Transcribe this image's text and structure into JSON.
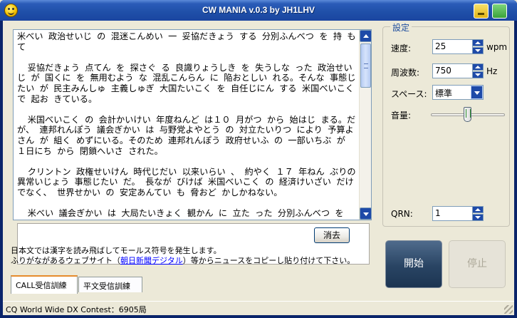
{
  "window": {
    "title": "CW MANIA v.0.3 by JH1LHV"
  },
  "text_area": {
    "content": "米べい 政治せいじ の 混迷こんめい 一 妥協だきょう する 分別ふんべつ を 持 もて\n\n  妥協だきょう 点てん を 探さぐ る 良識りょうしき を 失うしな った 政治せいじ が 国くに を 無用むよう な 混乱こんらん に 陥おとしい れる。そんな 事態じたい が 民主みんしゅ 主義しゅぎ 大国たいこく を 自任じにん する 米国べいこく で 起お きている。\n\n  米国べいこく の 会計かいけい 年度ねんど は１０ 月がつ から 始はじ まる。だが、 連邦れんぽう 議会ぎかい は 与野党よやとう の 対立たいりつ により 予算よさん が 組く めずにいる。そのため 連邦れんぽう 政府せいふ の 一部いちぶ が １日にち から 閉鎖へいさ された。\n\n  クリントン 政権せいけん 時代じだい 以来いらい 、 約やく １７ 年ねん ぶりの 異常いじょう 事態じたい だ。 長なが びけば 米国べいこく の 経済けいざい だけでなく、 世界せかい の 安定あんてい も 脅おど かしかねない。\n\n  米べい 議会ぎかい は 大局たいきょく 観かん に 立た った 分別ふんべつ を 取 と りもどし、 政府せいふ 機能きのう を 早はや く 正常せ"
  },
  "info": {
    "clear_button": "消去",
    "line1": "日本文では漢字を読み飛ばしてモールス符号を発生します。",
    "line2_prefix": "ふりがながあるウェブサイト（",
    "line2_link": "朝日新聞デジタル",
    "line2_suffix": "）等からニュースをコピーし貼り付けて下さい。"
  },
  "tabs": [
    {
      "label": "CALL受信訓練",
      "active": true
    },
    {
      "label": "平文受信訓練",
      "active": false
    }
  ],
  "status_bar": {
    "text": "CQ World Wide DX Contest：6905局"
  },
  "settings": {
    "group_title": "設定",
    "speed_label": "速度:",
    "speed_value": "25",
    "speed_unit": "wpm",
    "freq_label": "周波数:",
    "freq_value": "750",
    "freq_unit": "Hz",
    "space_label": "スペース:",
    "space_value": "標準",
    "volume_label": "音量:",
    "volume_level_fraction": 0.5,
    "qrn_label": "QRN:",
    "qrn_value": "1"
  },
  "actions": {
    "start_label": "開始",
    "stop_label": "停止"
  },
  "colors": {
    "titlebar": "#1f4fa8",
    "start_button": "#294463",
    "link": "#0000ff",
    "legend": "#1f4e9e"
  }
}
